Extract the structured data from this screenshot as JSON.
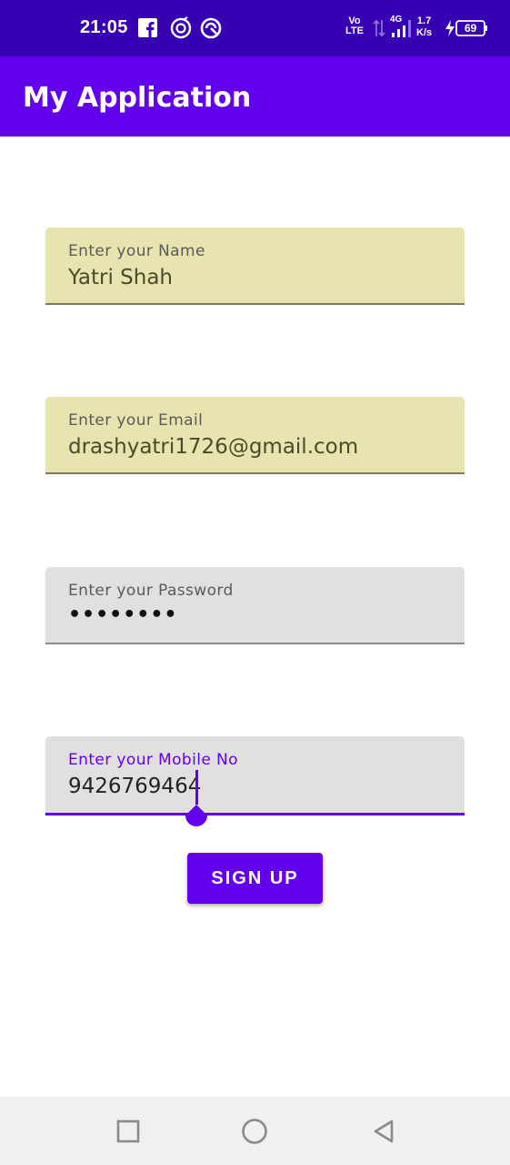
{
  "status_bar": {
    "time": "21:05",
    "icons": [
      "facebook-icon",
      "music-icon",
      "app-notification-icon"
    ],
    "network_label_top": "Vo",
    "network_label_bottom": "LTE",
    "network_type": "4G",
    "speed_value": "1.7",
    "speed_unit": "K/s",
    "battery_level": "69"
  },
  "app_bar": {
    "title": "My Application",
    "background": "#6200EE"
  },
  "form": {
    "name": {
      "label": "Enter your Name",
      "value": "Yatri Shah"
    },
    "email": {
      "label": "Enter your Email",
      "value": "drashyatri1726@gmail.com"
    },
    "password": {
      "label": "Enter your Password",
      "value": "••••••••"
    },
    "mobile": {
      "label": "Enter your Mobile No",
      "value": "9426769464"
    },
    "signup_label": "SIGN UP"
  },
  "nav_bar": {
    "buttons": [
      "recents-button",
      "home-button",
      "back-button"
    ]
  },
  "colors": {
    "primary": "#6200EE",
    "primary_dark": "#3700B3",
    "autofill": "#E8E4B0"
  }
}
